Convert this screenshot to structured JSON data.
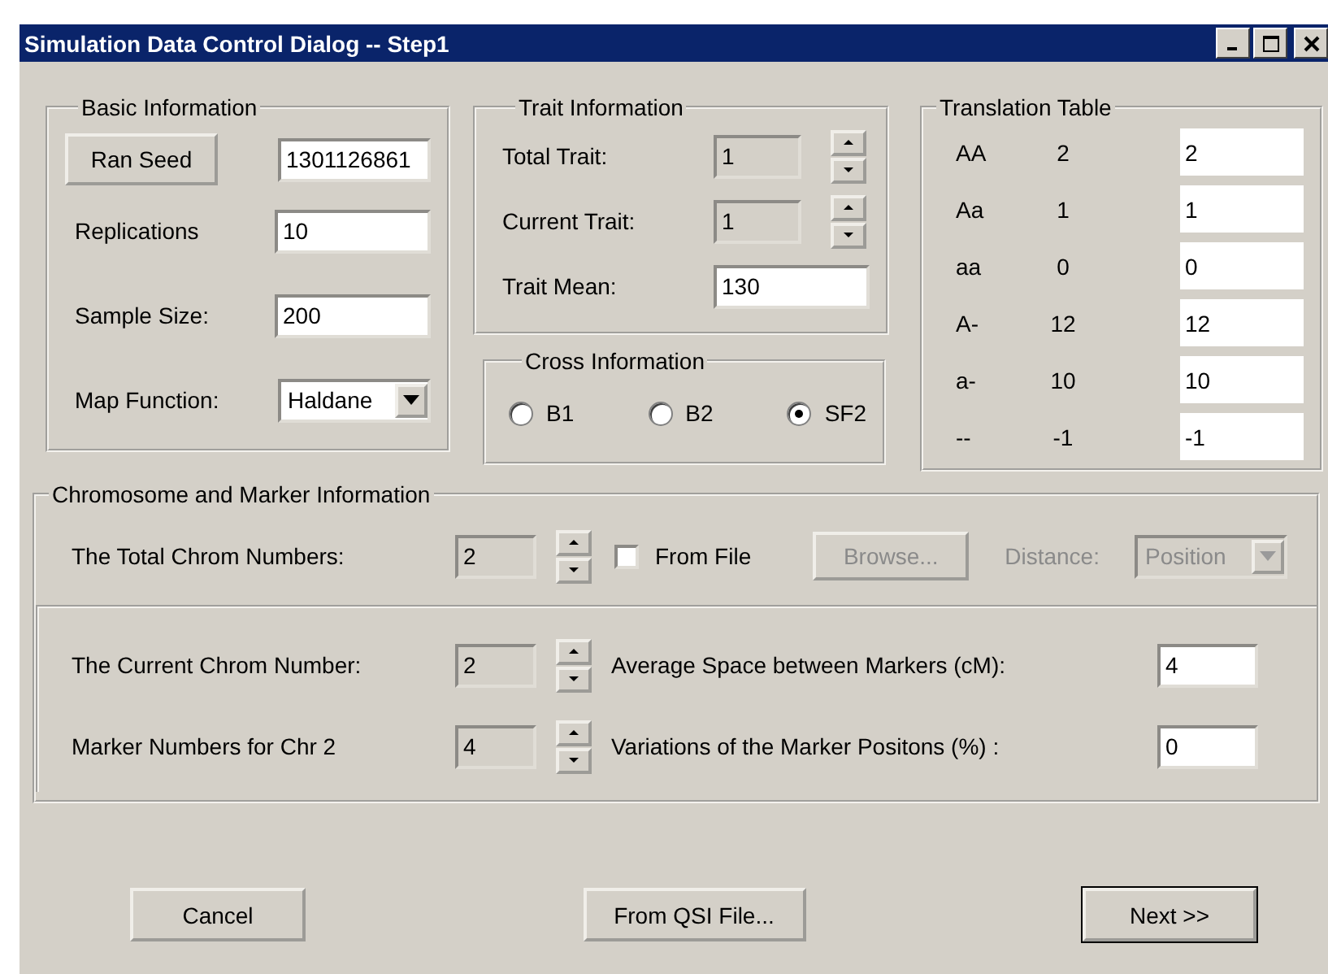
{
  "window": {
    "title": "Simulation Data Control Dialog -- Step1"
  },
  "basic": {
    "title": "Basic Information",
    "seed_button": "Ran Seed",
    "seed": "1301126861",
    "fields": [
      {
        "label": "Replications",
        "value": "10"
      },
      {
        "label": "Sample Size:",
        "value": "200"
      }
    ],
    "map_function": {
      "label": "Map Function:",
      "value": "Haldane"
    }
  },
  "trait": {
    "title": "Trait Information",
    "spinners": [
      {
        "label": "Total Trait:",
        "value": "1",
        "disabled": true
      },
      {
        "label": "Current Trait:",
        "value": "1",
        "disabled": true
      }
    ],
    "mean": {
      "label": "Trait Mean:",
      "value": "130"
    }
  },
  "cross": {
    "title": "Cross Information",
    "options": [
      {
        "label": "B1",
        "selected": false
      },
      {
        "label": "B2",
        "selected": false
      },
      {
        "label": "SF2",
        "selected": true
      }
    ]
  },
  "translation": {
    "title": "Translation Table",
    "rows": [
      {
        "genotype": "AA",
        "code": "2",
        "value": "2"
      },
      {
        "genotype": "Aa",
        "code": "1",
        "value": "1"
      },
      {
        "genotype": "aa",
        "code": "0",
        "value": "0"
      },
      {
        "genotype": "A-",
        "code": "12",
        "value": "12"
      },
      {
        "genotype": "a-",
        "code": "10",
        "value": "10"
      },
      {
        "genotype": "--",
        "code": "-1",
        "value": "-1"
      }
    ]
  },
  "chromosome": {
    "title": "Chromosome and Marker Information",
    "total": {
      "label": "The Total Chrom Numbers:",
      "value": "2",
      "disabled": true
    },
    "from_file": {
      "label": "From File",
      "checked": false
    },
    "browse": {
      "label": "Browse...",
      "disabled": true
    },
    "distance": {
      "label": "Distance:",
      "value": "Position",
      "disabled": true
    },
    "rows": [
      {
        "label": "The Current Chrom Number:",
        "value": "2",
        "disabled": true,
        "setting_label": "Average Space between Markers (cM):",
        "setting_value": "4"
      },
      {
        "label": "Marker Numbers for Chr 2",
        "value": "4",
        "disabled": true,
        "setting_label": "Variations of the Marker Positons (%) :",
        "setting_value": "0"
      }
    ]
  },
  "buttons": [
    {
      "label": "Cancel",
      "default": false
    },
    {
      "label": "From QSI File...",
      "default": false
    },
    {
      "label": "Next >>",
      "default": true
    }
  ]
}
